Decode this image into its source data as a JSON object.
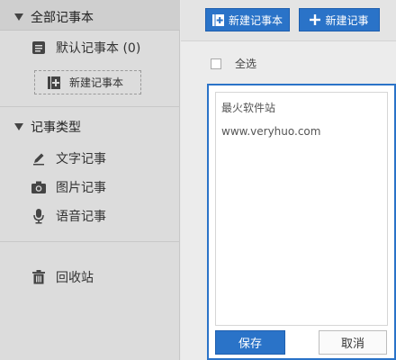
{
  "sidebar": {
    "all_notebooks": "全部记事本",
    "default_notebook": "默认记事本 (0)",
    "new_notebook": "新建记事本",
    "note_types_header": "记事类型",
    "note_types": [
      {
        "label": "文字记事",
        "icon": "pencil-icon"
      },
      {
        "label": "图片记事",
        "icon": "camera-icon"
      },
      {
        "label": "语音记事",
        "icon": "microphone-icon"
      }
    ],
    "recycle_bin": "回收站"
  },
  "toolbar": {
    "new_notebook_label": "新建记事本",
    "new_note_label": "新建记事"
  },
  "list": {
    "select_all_label": "全选"
  },
  "editor": {
    "lines": [
      "最火软件站",
      "www.veryhuo.com"
    ],
    "save_label": "保存",
    "cancel_label": "取消"
  },
  "colors": {
    "accent": "#2a73c8",
    "sidebar_bg": "#dcdcdc",
    "main_bg": "#ececec"
  }
}
